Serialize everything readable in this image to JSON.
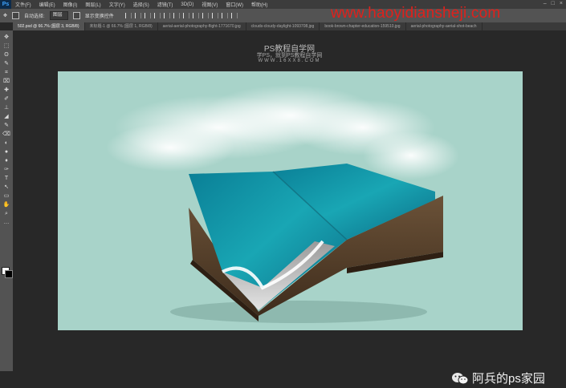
{
  "app": {
    "logo": "Ps"
  },
  "menu": [
    "文件(F)",
    "编辑(E)",
    "图像(I)",
    "图层(L)",
    "文字(Y)",
    "选择(S)",
    "滤镜(T)",
    "3D(D)",
    "视图(V)",
    "窗口(W)",
    "帮助(H)"
  ],
  "window_buttons": [
    "–",
    "□",
    "×"
  ],
  "options": {
    "auto_select_label": "自动选择:",
    "auto_select_value": "图层",
    "show_transform_label": "显示变换控件"
  },
  "watermark_url": "www.haoyidiansheji.com",
  "tabs": [
    "502.psd @ 66.7% (图层 3, RGB/8)",
    "未标题-1 @ 66.7% (图层 1, RGB/8)",
    "aerial-aerial-photography-flight-1771670.jpg",
    "clouds-cloudy-daylight-1093708.jpg",
    "book-brown-chapter-education-159510.jpg",
    "aerial-photography-aerial-shot-beach"
  ],
  "tools": [
    "✥",
    "⬚",
    "ʘ",
    "✎",
    "⌗",
    "⌧",
    "✚",
    "✐",
    "⊥",
    "◢",
    "✎",
    "⌫",
    "◐",
    "●",
    "♦",
    "✑",
    "T",
    "↖",
    "▭",
    "✋",
    "⌕",
    "…"
  ],
  "colors": {
    "foreground": "#ffffff",
    "background": "#000000",
    "accent_red": "#e0201b"
  },
  "site": {
    "title": "PS教程自学网",
    "subtitle": "学PS，就到PS教程自学网",
    "url": "WWW.16XX8.COM"
  },
  "footer": {
    "brand": "阿兵的ps家园",
    "icon": "wechat-icon"
  }
}
